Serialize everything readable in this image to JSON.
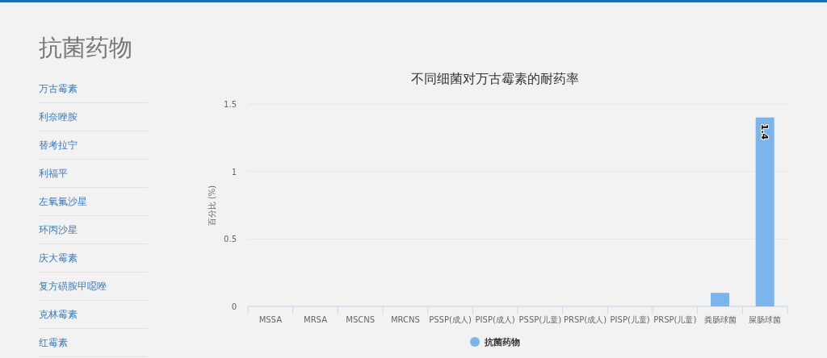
{
  "page_title": "抗菌药物",
  "sidebar": {
    "items": [
      {
        "label": "万古霉素"
      },
      {
        "label": "利奈唑胺"
      },
      {
        "label": "替考拉宁"
      },
      {
        "label": "利福平"
      },
      {
        "label": "左氧氟沙星"
      },
      {
        "label": "环丙沙星"
      },
      {
        "label": "庆大霉素"
      },
      {
        "label": "复方磺胺甲噁唑"
      },
      {
        "label": "克林霉素"
      },
      {
        "label": "红霉素"
      }
    ]
  },
  "chart": {
    "chart_data": {
      "type": "bar",
      "title": "不同细菌对万古霉素的耐药率",
      "ylabel": "百分比 (%)",
      "categories": [
        "MSSA",
        "MRSA",
        "MSCNS",
        "MRCNS",
        "PSSP(成人)",
        "PISP(成人)",
        "PSSP(儿童)",
        "PRSP(成人)",
        "PISP(儿童)",
        "PRSP(儿童)",
        "粪肠球菌",
        "屎肠球菌"
      ],
      "series": [
        {
          "name": "抗菌药物",
          "color": "#7cb5ec",
          "values": [
            0,
            0,
            0,
            0,
            0,
            0,
            0,
            0,
            0,
            0,
            0.1,
            1.4
          ]
        }
      ],
      "ylim": [
        0,
        1.5
      ],
      "yticks": [
        0,
        0.5,
        1,
        1.5
      ],
      "value_labels": [
        null,
        null,
        null,
        null,
        null,
        null,
        null,
        null,
        null,
        null,
        null,
        "1.4"
      ]
    }
  }
}
